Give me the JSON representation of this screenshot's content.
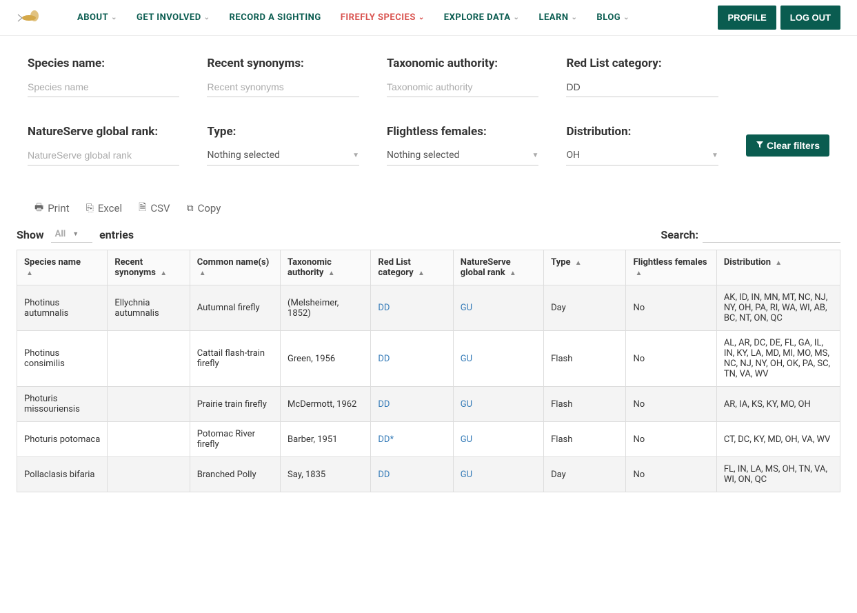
{
  "nav": {
    "items": [
      {
        "label": "ABOUT",
        "dropdown": true,
        "active": false
      },
      {
        "label": "GET INVOLVED",
        "dropdown": true,
        "active": false
      },
      {
        "label": "RECORD A SIGHTING",
        "dropdown": false,
        "active": false
      },
      {
        "label": "FIREFLY SPECIES",
        "dropdown": true,
        "active": true
      },
      {
        "label": "EXPLORE DATA",
        "dropdown": true,
        "active": false
      },
      {
        "label": "LEARN",
        "dropdown": true,
        "active": false
      },
      {
        "label": "BLOG",
        "dropdown": true,
        "active": false
      }
    ],
    "profile": "PROFILE",
    "logout": "LOG OUT"
  },
  "filters": {
    "species_name": {
      "label": "Species name:",
      "placeholder": "Species name",
      "value": ""
    },
    "recent_synonyms": {
      "label": "Recent synonyms:",
      "placeholder": "Recent synonyms",
      "value": ""
    },
    "taxonomic_authority": {
      "label": "Taxonomic authority:",
      "placeholder": "Taxonomic authority",
      "value": ""
    },
    "red_list": {
      "label": "Red List category:",
      "value": "DD"
    },
    "natureserve": {
      "label": "NatureServe global rank:",
      "placeholder": "NatureServe global rank",
      "value": ""
    },
    "type": {
      "label": "Type:",
      "value": "Nothing selected"
    },
    "flightless": {
      "label": "Flightless females:",
      "value": "Nothing selected"
    },
    "distribution": {
      "label": "Distribution:",
      "value": "OH"
    },
    "clear": "Clear filters"
  },
  "export": {
    "print": "Print",
    "excel": "Excel",
    "csv": "CSV",
    "copy": "Copy"
  },
  "table_controls": {
    "show": "Show",
    "entries": "entries",
    "show_value": "All",
    "search": "Search:"
  },
  "columns": [
    "Species name",
    "Recent synonyms",
    "Common name(s)",
    "Taxonomic authority",
    "Red List category",
    "NatureServe global rank",
    "Type",
    "Flightless females",
    "Distribution"
  ],
  "rows": [
    {
      "species": "Photinus autumnalis",
      "synonyms": "Ellychnia autumnalis",
      "common": "Autumnal firefly",
      "authority": "(Melsheimer, 1852)",
      "redlist": "DD",
      "natureserve": "GU",
      "type": "Day",
      "flightless": "No",
      "distribution": "AK, ID, IN, MN, MT, NC, NJ, NY, OH, PA, RI, WA, WI, AB, BC, NT, ON, QC"
    },
    {
      "species": "Photinus consimilis",
      "synonyms": "",
      "common": "Cattail flash-train firefly",
      "authority": "Green, 1956",
      "redlist": "DD",
      "natureserve": "GU",
      "type": "Flash",
      "flightless": "No",
      "distribution": "AL, AR, DC, DE, FL, GA, IL, IN, KY, LA, MD, MI, MO, MS, NC, NJ, NY, OH, OK, PA, SC, TN, VA, WV"
    },
    {
      "species": "Photuris missouriensis",
      "synonyms": "",
      "common": "Prairie train firefly",
      "authority": "McDermott, 1962",
      "redlist": "DD",
      "natureserve": "GU",
      "type": "Flash",
      "flightless": "No",
      "distribution": "AR, IA, KS, KY, MO, OH"
    },
    {
      "species": "Photuris potomaca",
      "synonyms": "",
      "common": "Potomac River firefly",
      "authority": "Barber, 1951",
      "redlist": "DD*",
      "natureserve": "GU",
      "type": "Flash",
      "flightless": "No",
      "distribution": "CT, DC, KY, MD, OH, VA, WV"
    },
    {
      "species": "Pollaclasis bifaria",
      "synonyms": "",
      "common": "Branched Polly",
      "authority": "Say, 1835",
      "redlist": "DD",
      "natureserve": "GU",
      "type": "Day",
      "flightless": "No",
      "distribution": "FL, IN, LA, MS, OH, TN, VA, WI, ON, QC"
    }
  ]
}
